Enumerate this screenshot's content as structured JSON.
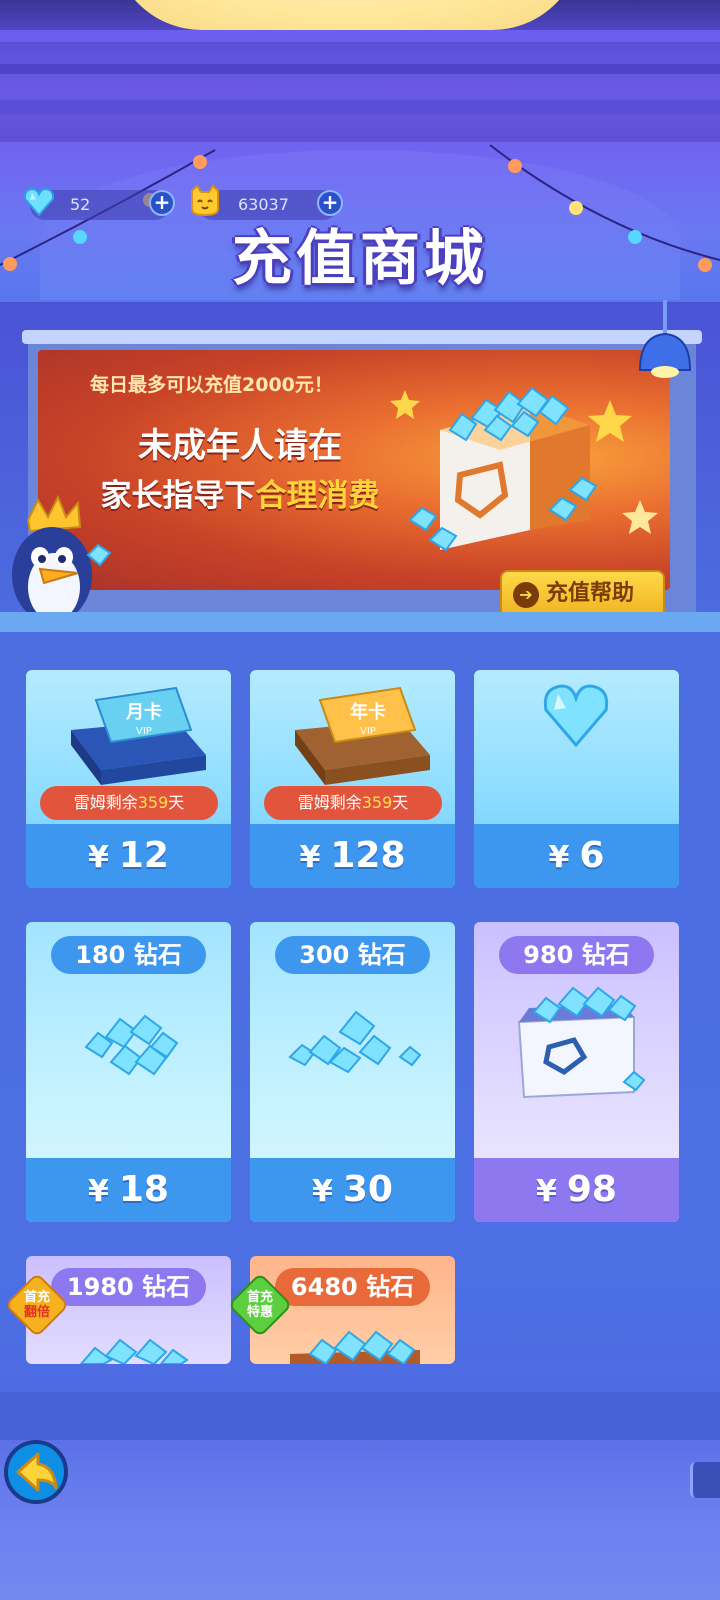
{
  "header": {
    "title": "充值商城",
    "diamonds": {
      "icon": "blue-heart-diamond-icon",
      "value": "52"
    },
    "coins": {
      "icon": "cat-coin-icon",
      "value": "63037"
    }
  },
  "banner": {
    "line1": "每日最多可以充值2000元！",
    "line2": "未成年人请在",
    "line3_prefix": "家长指导下",
    "line3_highlight": "合理消费",
    "help_button": "充值帮助"
  },
  "cards": [
    {
      "kind": "monthly-card",
      "art_label": "月卡",
      "tag_prefix": "雷姆剩余",
      "tag_days": "359",
      "tag_suffix": "天",
      "price": "12",
      "currency": "¥"
    },
    {
      "kind": "yearly-card",
      "art_label": "年卡",
      "tag_prefix": "雷姆剩余",
      "tag_days": "359",
      "tag_suffix": "天",
      "price": "128",
      "currency": "¥"
    },
    {
      "kind": "single-diamond",
      "price": "6",
      "currency": "¥"
    },
    {
      "kind": "diamonds",
      "amount": "180 钻石",
      "price": "18",
      "currency": "¥"
    },
    {
      "kind": "diamonds",
      "amount": "300 钻石",
      "price": "30",
      "currency": "¥"
    },
    {
      "kind": "diamond-box",
      "amount": "980 钻石",
      "price": "98",
      "currency": "¥"
    },
    {
      "kind": "diamond-pile",
      "amount": "1980 钻石",
      "badge_line1": "首充",
      "badge_line2": "翻倍"
    },
    {
      "kind": "diamond-box-large",
      "amount": "6480 钻石",
      "badge_line1": "首充",
      "badge_line2": "特惠"
    }
  ],
  "colors": {
    "accent_yellow": "#ffd33a",
    "price_blue": "#3e97ee",
    "price_purple": "#8d78ef",
    "tag_red": "#e2553c"
  }
}
